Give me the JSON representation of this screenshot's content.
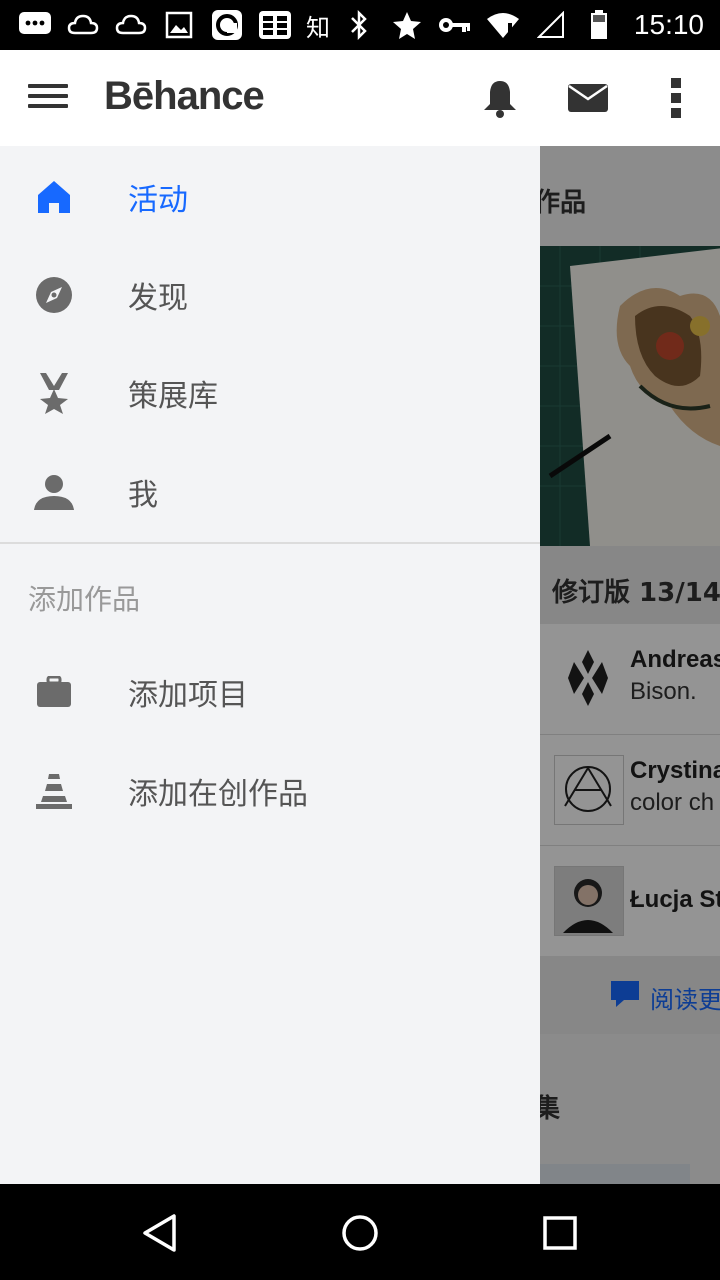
{
  "status_bar": {
    "left_icons": [
      "chat-bubble-icon",
      "cloud-icon",
      "cloud-icon",
      "image-icon",
      "sync-app-icon",
      "grid-app-icon"
    ],
    "kanji": "知",
    "right_icons": [
      "bluetooth-icon",
      "star-icon",
      "key-icon",
      "wifi-icon",
      "signal-icon",
      "battery-icon"
    ],
    "time": "15:10"
  },
  "app_bar": {
    "logo": "Bēhance",
    "icons": [
      "notifications-icon",
      "messages-icon",
      "overflow-menu-icon"
    ]
  },
  "drawer": {
    "items": [
      {
        "label": "活动",
        "icon": "home-icon",
        "active": true
      },
      {
        "label": "发现",
        "icon": "compass-icon",
        "active": false
      },
      {
        "label": "策展库",
        "icon": "ribbon-star-icon",
        "active": false
      },
      {
        "label": "我",
        "icon": "person-icon",
        "active": false
      }
    ],
    "section_header": "添加作品",
    "add_items": [
      {
        "label": "添加项目",
        "icon": "briefcase-icon"
      },
      {
        "label": "添加在创作品",
        "icon": "cone-icon"
      }
    ]
  },
  "background_feed": {
    "title": "作品",
    "revision": "修订版 13/14",
    "rows": [
      {
        "name": "Andreas",
        "desc": "Bison."
      },
      {
        "name": "Crystina",
        "desc": "color ch"
      },
      {
        "name": "Łucja St",
        "desc": ""
      }
    ],
    "read_more": "阅读更",
    "collection": "集"
  },
  "colors": {
    "accent": "#1769ff",
    "drawer_bg": "#f3f4f6",
    "icon_gray": "#666666"
  }
}
